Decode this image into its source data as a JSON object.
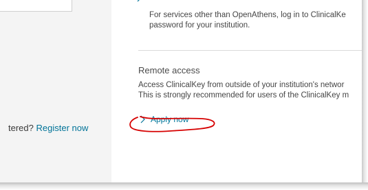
{
  "left_panel": {
    "register_prefix": "tered?",
    "register_link": "Register now"
  },
  "main": {
    "services_line_1": "For services other than OpenAthens, log in to ClinicalKe",
    "services_line_2": "password for your institution.",
    "remote_heading": "Remote access",
    "remote_line_1": "Access ClinicalKey from outside of your institution's networ",
    "remote_line_2": "This is strongly recommended for users of the ClinicalKey m",
    "apply_label": "Apply now"
  },
  "colors": {
    "link": "#007398",
    "annotation": "#d60000"
  },
  "icons": {
    "apply_chevron": "chevron-right-icon",
    "top_chevron": "chevron-right-icon"
  }
}
